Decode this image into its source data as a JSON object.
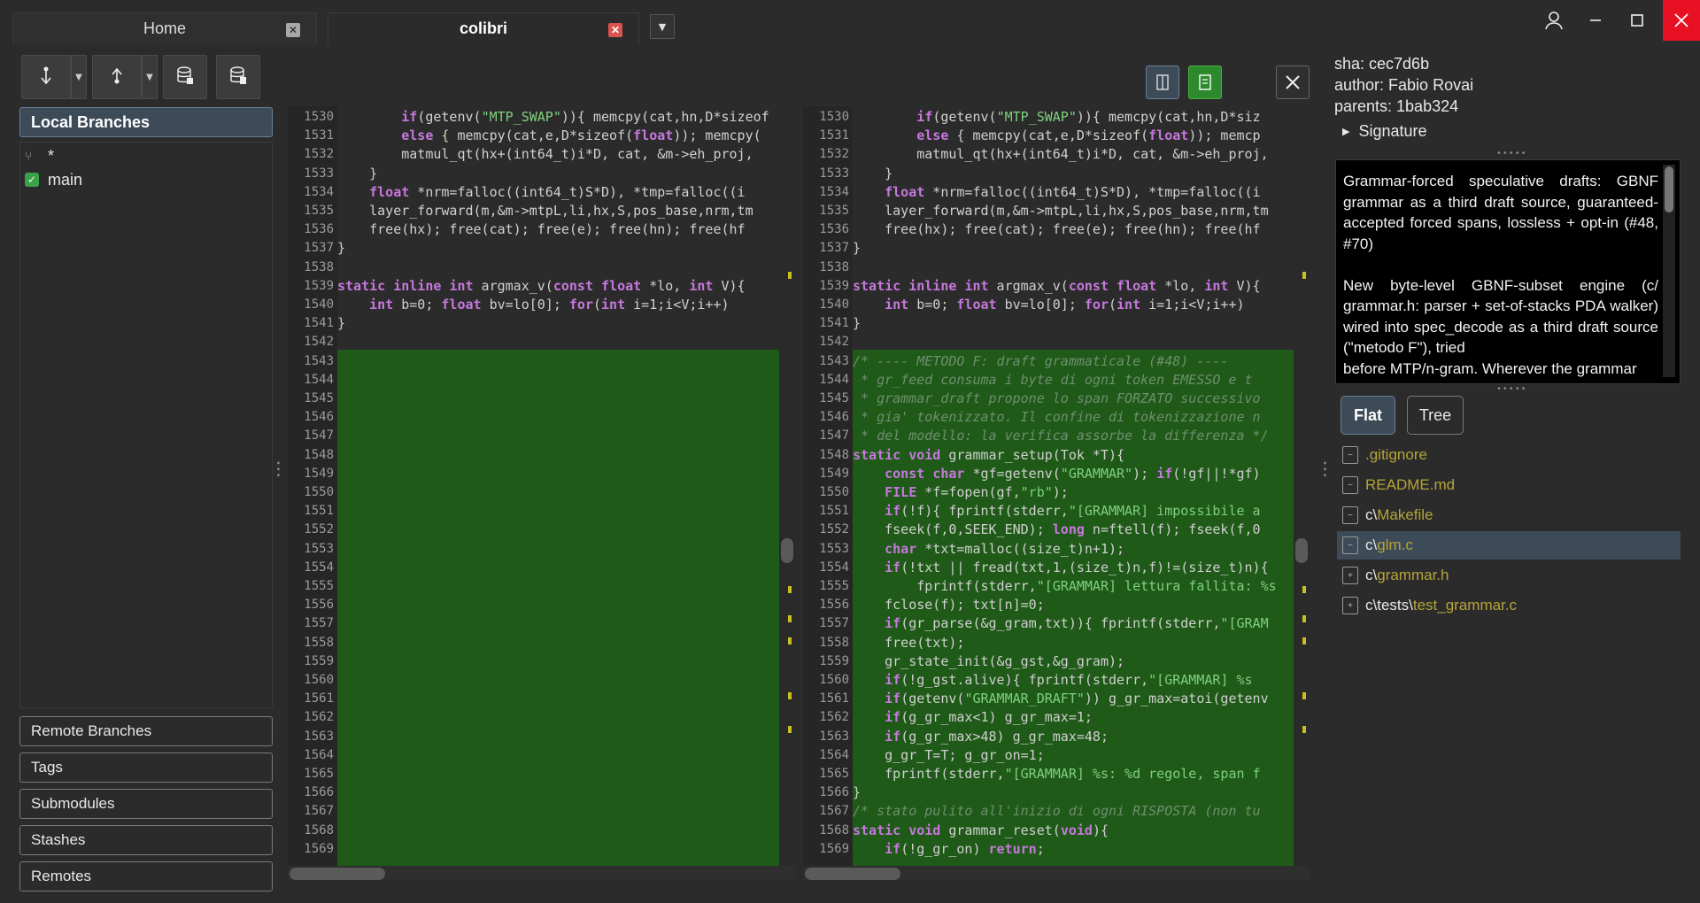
{
  "tabs": [
    {
      "label": "Home"
    },
    {
      "label": "colibri"
    }
  ],
  "window": {
    "close_label": "✕",
    "min_label": "—",
    "max_label": "☐"
  },
  "left": {
    "local_branches_label": "Local Branches",
    "branches": [
      {
        "name": "*",
        "checked": false
      },
      {
        "name": "main",
        "checked": true
      }
    ],
    "sections": [
      "Remote Branches",
      "Tags",
      "Submodules",
      "Stashes",
      "Remotes"
    ]
  },
  "diff": {
    "left_lines": [
      {
        "n": "1530",
        "t": "        if(getenv(\"MTP_SWAP\")){ memcpy(cat,hn,D*sizeof"
      },
      {
        "n": "1531",
        "t": "        else { memcpy(cat,e,D*sizeof(float)); memcpy("
      },
      {
        "n": "1532",
        "t": "        matmul_qt(hx+(int64_t)i*D, cat, &m->eh_proj,"
      },
      {
        "n": "1533",
        "t": "    }"
      },
      {
        "n": "1534",
        "t": "    float *nrm=falloc((int64_t)S*D), *tmp=falloc((i"
      },
      {
        "n": "1535",
        "t": "    layer_forward(m,&m->mtpL,li,hx,S,pos_base,nrm,tm"
      },
      {
        "n": "1536",
        "t": "    free(hx); free(cat); free(e); free(hn); free(hf"
      },
      {
        "n": "1537",
        "t": "}"
      },
      {
        "n": "1538",
        "t": ""
      },
      {
        "n": "1539",
        "t": "static inline int argmax_v(const float *lo, int V){"
      },
      {
        "n": "1540",
        "t": "    int b=0; float bv=lo[0]; for(int i=1;i<V;i++)"
      },
      {
        "n": "1541",
        "t": "}"
      },
      {
        "n": "1542",
        "t": ""
      },
      {
        "n": "1543",
        "t": ""
      },
      {
        "n": "1544",
        "t": ""
      },
      {
        "n": "1545",
        "t": ""
      },
      {
        "n": "1546",
        "t": ""
      },
      {
        "n": "1547",
        "t": ""
      },
      {
        "n": "1548",
        "t": ""
      },
      {
        "n": "1549",
        "t": ""
      },
      {
        "n": "1550",
        "t": ""
      },
      {
        "n": "1551",
        "t": ""
      },
      {
        "n": "1552",
        "t": ""
      },
      {
        "n": "1553",
        "t": ""
      },
      {
        "n": "1554",
        "t": ""
      },
      {
        "n": "1555",
        "t": ""
      },
      {
        "n": "1556",
        "t": ""
      },
      {
        "n": "1557",
        "t": ""
      },
      {
        "n": "1558",
        "t": ""
      },
      {
        "n": "1559",
        "t": ""
      },
      {
        "n": "1560",
        "t": ""
      },
      {
        "n": "1561",
        "t": ""
      },
      {
        "n": "1562",
        "t": ""
      },
      {
        "n": "1563",
        "t": ""
      },
      {
        "n": "1564",
        "t": ""
      },
      {
        "n": "1565",
        "t": ""
      },
      {
        "n": "1566",
        "t": ""
      },
      {
        "n": "1567",
        "t": ""
      },
      {
        "n": "1568",
        "t": ""
      },
      {
        "n": "1569",
        "t": ""
      }
    ],
    "right_lines": [
      {
        "n": "1530",
        "t": "        if(getenv(\"MTP_SWAP\")){ memcpy(cat,hn,D*siz"
      },
      {
        "n": "1531",
        "t": "        else { memcpy(cat,e,D*sizeof(float)); memcp"
      },
      {
        "n": "1532",
        "t": "        matmul_qt(hx+(int64_t)i*D, cat, &m->eh_proj,"
      },
      {
        "n": "1533",
        "t": "    }"
      },
      {
        "n": "1534",
        "t": "    float *nrm=falloc((int64_t)S*D), *tmp=falloc((i"
      },
      {
        "n": "1535",
        "t": "    layer_forward(m,&m->mtpL,li,hx,S,pos_base,nrm,tm"
      },
      {
        "n": "1536",
        "t": "    free(hx); free(cat); free(e); free(hn); free(hf"
      },
      {
        "n": "1537",
        "t": "}"
      },
      {
        "n": "1538",
        "t": ""
      },
      {
        "n": "1539",
        "t": "static inline int argmax_v(const float *lo, int V){"
      },
      {
        "n": "1540",
        "t": "    int b=0; float bv=lo[0]; for(int i=1;i<V;i++)"
      },
      {
        "n": "1541",
        "t": "}"
      },
      {
        "n": "1542",
        "t": ""
      },
      {
        "n": "1543",
        "t": "/* ---- METODO F: draft grammaticale (#48) ----"
      },
      {
        "n": "1544",
        "t": " * gr_feed consuma i byte di ogni token EMESSO e t"
      },
      {
        "n": "1545",
        "t": " * grammar_draft propone lo span FORZATO successivo"
      },
      {
        "n": "1546",
        "t": " * gia' tokenizzato. Il confine di tokenizzazione n"
      },
      {
        "n": "1547",
        "t": " * del modello: la verifica assorbe la differenza */"
      },
      {
        "n": "1548",
        "t": "static void grammar_setup(Tok *T){"
      },
      {
        "n": "1549",
        "t": "    const char *gf=getenv(\"GRAMMAR\"); if(!gf||!*gf)"
      },
      {
        "n": "1550",
        "t": "    FILE *f=fopen(gf,\"rb\");"
      },
      {
        "n": "1551",
        "t": "    if(!f){ fprintf(stderr,\"[GRAMMAR] impossibile a"
      },
      {
        "n": "1552",
        "t": "    fseek(f,0,SEEK_END); long n=ftell(f); fseek(f,0"
      },
      {
        "n": "1553",
        "t": "    char *txt=malloc((size_t)n+1);"
      },
      {
        "n": "1554",
        "t": "    if(!txt || fread(txt,1,(size_t)n,f)!=(size_t)n){"
      },
      {
        "n": "1555",
        "t": "        fprintf(stderr,\"[GRAMMAR] lettura fallita: %s"
      },
      {
        "n": "1556",
        "t": "    fclose(f); txt[n]=0;"
      },
      {
        "n": "1557",
        "t": "    if(gr_parse(&g_gram,txt)){ fprintf(stderr,\"[GRAM"
      },
      {
        "n": "1558",
        "t": "    free(txt);"
      },
      {
        "n": "1559",
        "t": "    gr_state_init(&g_gst,&g_gram);"
      },
      {
        "n": "1560",
        "t": "    if(!g_gst.alive){ fprintf(stderr,\"[GRAMMAR] %s"
      },
      {
        "n": "1561",
        "t": "    if(getenv(\"GRAMMAR_DRAFT\")) g_gr_max=atoi(getenv"
      },
      {
        "n": "1562",
        "t": "    if(g_gr_max<1) g_gr_max=1;"
      },
      {
        "n": "1563",
        "t": "    if(g_gr_max>48) g_gr_max=48;"
      },
      {
        "n": "1564",
        "t": "    g_gr_T=T; g_gr_on=1;"
      },
      {
        "n": "1565",
        "t": "    fprintf(stderr,\"[GRAMMAR] %s: %d regole, span f"
      },
      {
        "n": "1566",
        "t": "}"
      },
      {
        "n": "1567",
        "t": "/* stato pulito all'inizio di ogni RISPOSTA (non tu"
      },
      {
        "n": "1568",
        "t": "static void grammar_reset(void){"
      },
      {
        "n": "1569",
        "t": "    if(!g_gr_on) return;"
      }
    ]
  },
  "commit": {
    "sha": "sha: cec7d6b",
    "author": "author: Fabio Rovai",
    "parents": "parents: 1bab324",
    "signature_label": "Signature",
    "message": "Grammar-forced speculative drafts: GBNF grammar as a third draft source, guaranteed-accepted forced spans, lossless + opt-in (#48, #70)\n\nNew byte-level GBNF-subset engine (c/ grammar.h: parser + set-of-stacks PDA walker) wired into spec_decode as a third draft source (\"metodo F\"), tried\nbefore MTP/n-gram. Wherever the grammar"
  },
  "view": {
    "flat_label": "Flat",
    "tree_label": "Tree"
  },
  "files": [
    {
      "dir": "",
      "name": ".gitignore",
      "selected": false,
      "icon": "file-modified-icon"
    },
    {
      "dir": "",
      "name": "README.md",
      "selected": false,
      "icon": "file-modified-icon"
    },
    {
      "dir": "c\\",
      "name": "Makefile",
      "selected": false,
      "icon": "file-modified-icon"
    },
    {
      "dir": "c\\",
      "name": "glm.c",
      "selected": true,
      "icon": "file-modified-icon"
    },
    {
      "dir": "c\\",
      "name": "grammar.h",
      "selected": false,
      "icon": "file-added-icon"
    },
    {
      "dir": "c\\tests\\",
      "name": "test_grammar.c",
      "selected": false,
      "icon": "file-added-icon"
    }
  ]
}
